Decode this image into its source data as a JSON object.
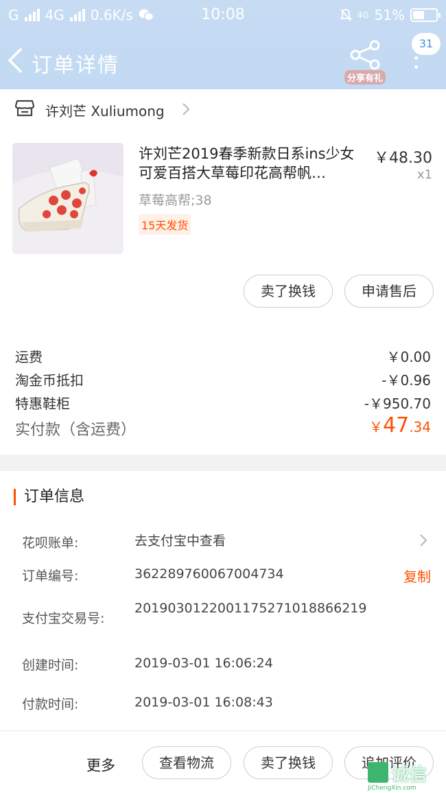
{
  "status_bar": {
    "carrier": "G",
    "network": "4G",
    "speed": "0.6K/s",
    "time": "10:08",
    "network_right": "4G",
    "battery": "51%",
    "battery_level": 0.51
  },
  "nav": {
    "title": "订单详情",
    "share_label": "分享有礼",
    "badge": "31"
  },
  "shop": {
    "name": "许刘芒 Xuliumong"
  },
  "product": {
    "title": "许刘芒2019春季新款日系ins少女可爱百搭大草莓印花高帮帆…",
    "price": "￥48.30",
    "quantity": "x1",
    "spec": "草莓高帮;38",
    "ship_tag": "15天发货"
  },
  "item_actions": {
    "sell": "卖了换钱",
    "after_sale": "申请售后"
  },
  "fees": [
    {
      "label": "运费",
      "value": "￥0.00"
    },
    {
      "label": "淘金币抵扣",
      "value": "-￥0.96"
    },
    {
      "label": "特惠鞋柜",
      "value": "-￥950.70"
    }
  ],
  "paid": {
    "label": "实付款（含运费）",
    "currency": "￥",
    "integer": "47",
    "decimal": ".34"
  },
  "order_info": {
    "heading": "订单信息",
    "rows": [
      {
        "label": "花呗账单:",
        "value": "去支付宝中查看"
      },
      {
        "label": "订单编号:",
        "value": "362289760067004734"
      },
      {
        "label": "支付宝交易号:",
        "value": "2019030122001175271018866219"
      },
      {
        "label": "创建时间:",
        "value": "2019-03-01 16:06:24"
      },
      {
        "label": "付款时间:",
        "value": "2019-03-01 16:08:43"
      }
    ],
    "copy_label": "复制"
  },
  "bottom": {
    "more": "更多",
    "logistics": "查看物流",
    "sell": "卖了换钱",
    "review": "追加评价"
  },
  "watermark": {
    "text": "诚信",
    "sub": "JiChengXin.com"
  }
}
